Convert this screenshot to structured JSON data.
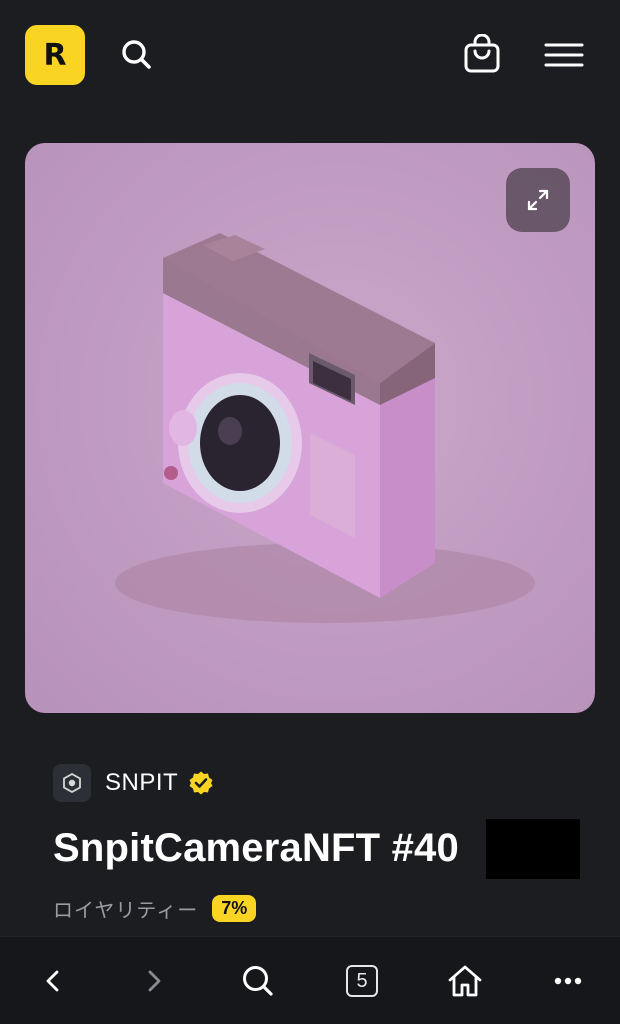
{
  "header": {
    "logo_letter": "R",
    "icons": {
      "search": "search-icon",
      "cart": "shopping-bag-icon",
      "menu": "hamburger-menu-icon"
    }
  },
  "media": {
    "expand_icon": "expand-icon",
    "image_subject": "pink-camera-nft-artwork"
  },
  "creator": {
    "name": "SNPIT",
    "verified": true
  },
  "nft": {
    "title": "SnpitCameraNFT #40"
  },
  "royalty": {
    "label": "ロイヤリティー",
    "value": "7%"
  },
  "browser_bar": {
    "tab_count": "5",
    "icons": [
      "back-arrow-icon",
      "forward-arrow-icon",
      "search-icon",
      "tabs-icon",
      "home-icon",
      "more-icon"
    ]
  },
  "colors": {
    "background": "#1b1d21",
    "accent": "#f9d423",
    "card_bg": "#c29dc3",
    "muted_text": "#9a9ca2"
  }
}
